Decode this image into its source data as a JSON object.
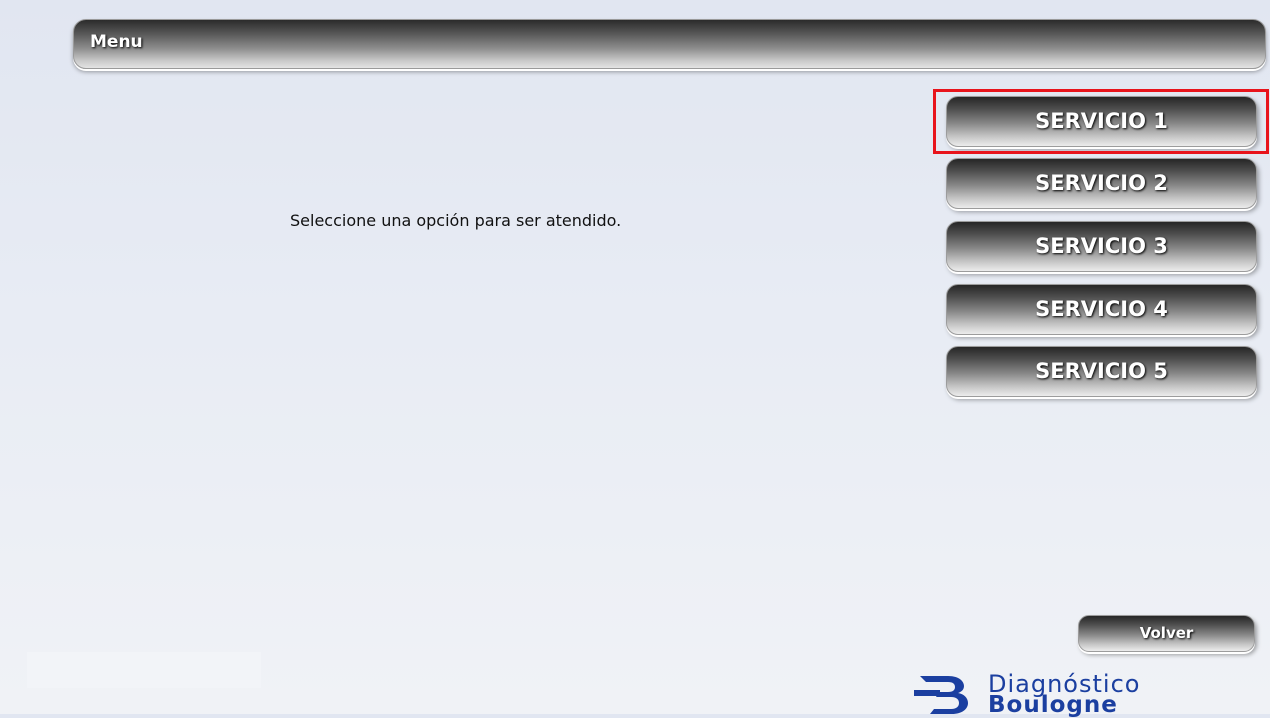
{
  "header": {
    "title": "Menu"
  },
  "main": {
    "message": "Seleccione una opción para ser atendido."
  },
  "services": [
    {
      "label": "SERVICIO 1",
      "highlighted": true
    },
    {
      "label": "SERVICIO 2",
      "highlighted": false
    },
    {
      "label": "SERVICIO 3",
      "highlighted": false
    },
    {
      "label": "SERVICIO 4",
      "highlighted": false
    },
    {
      "label": "SERVICIO 5",
      "highlighted": false
    }
  ],
  "footer": {
    "back_label": "Volver",
    "logo_line1": "Diagnóstico",
    "logo_line2": "Boulogne"
  },
  "colors": {
    "highlight": "#e8141c",
    "brand": "#1b3fa0"
  }
}
